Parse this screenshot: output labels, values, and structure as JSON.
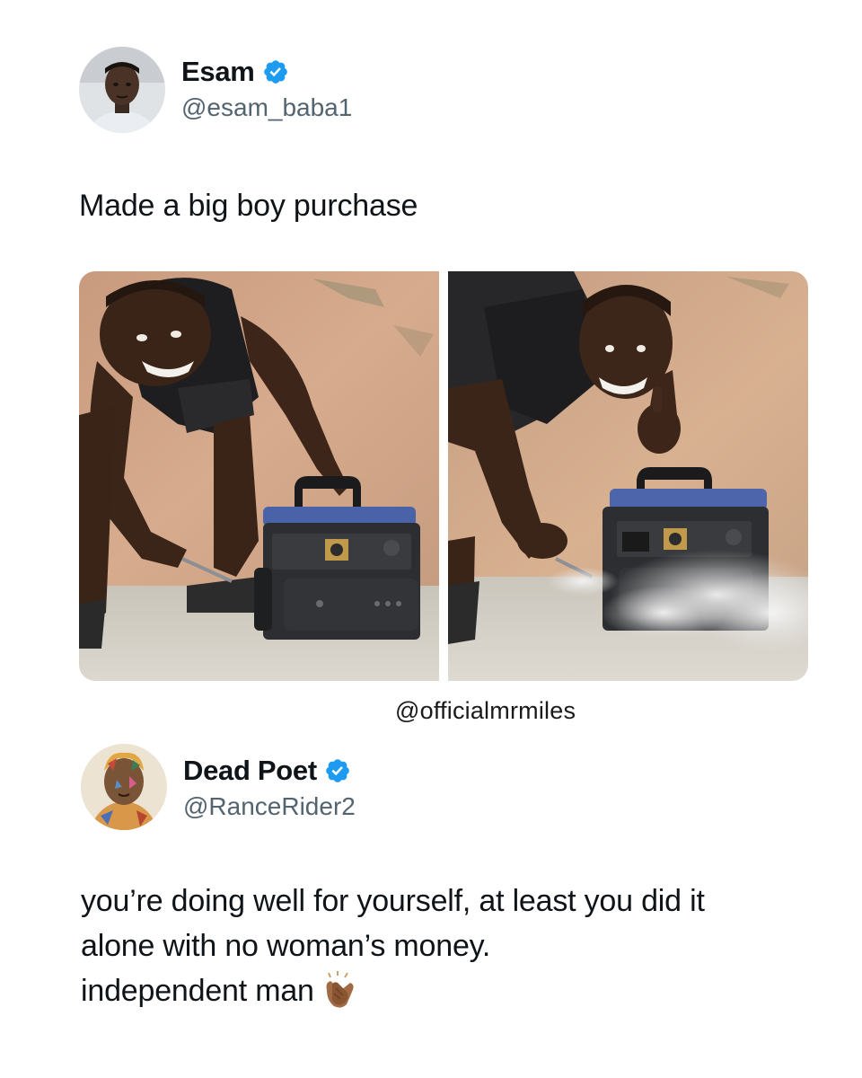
{
  "tweet1": {
    "display_name": "Esam",
    "handle": "@esam_baba1",
    "verified": true,
    "text": "Made a big boy purchase",
    "media": {
      "photo_1": "man-crouching-with-generator",
      "photo_2": "man-thumbs-up-generator-smoking"
    }
  },
  "watermark": "@officialmrmiles",
  "tweet2": {
    "display_name": "Dead Poet",
    "handle": "@RanceRider2",
    "verified": true,
    "text_lines": [
      "you’re doing well for yourself, at least you did it",
      "alone with no woman’s money.",
      "independent man"
    ],
    "emoji": "clapping-hands-icon"
  },
  "colors": {
    "verified_blue": "#1d9bf0",
    "handle_gray": "#536471",
    "text": "#0f1419"
  }
}
